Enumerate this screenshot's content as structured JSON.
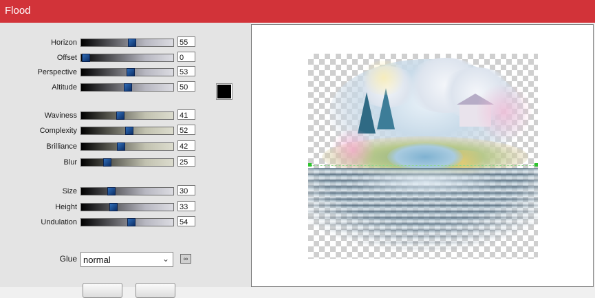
{
  "window": {
    "title": "Flood"
  },
  "sliders": [
    {
      "id": "horizon",
      "label": "Horizon",
      "value": "55",
      "fraction": 0.55,
      "style": "gray"
    },
    {
      "id": "offset",
      "label": "Offset",
      "value": "0",
      "fraction": 0.0,
      "style": "gray"
    },
    {
      "id": "perspective",
      "label": "Perspective",
      "value": "53",
      "fraction": 0.53,
      "style": "gray"
    },
    {
      "id": "altitude",
      "label": "Altitude",
      "value": "50",
      "fraction": 0.5,
      "style": "gray"
    },
    {
      "id": "waviness",
      "label": "Waviness",
      "value": "41",
      "fraction": 0.41,
      "style": "tan"
    },
    {
      "id": "complexity",
      "label": "Complexity",
      "value": "52",
      "fraction": 0.52,
      "style": "tan"
    },
    {
      "id": "brilliance",
      "label": "Brilliance",
      "value": "42",
      "fraction": 0.42,
      "style": "tan"
    },
    {
      "id": "blur",
      "label": "Blur",
      "value": "25",
      "fraction": 0.25,
      "style": "tan"
    },
    {
      "id": "size",
      "label": "Size",
      "value": "30",
      "fraction": 0.3,
      "style": "gray"
    },
    {
      "id": "height",
      "label": "Height",
      "value": "33",
      "fraction": 0.33,
      "style": "gray"
    },
    {
      "id": "undulation",
      "label": "Undulation",
      "value": "54",
      "fraction": 0.54,
      "style": "gray"
    }
  ],
  "color_swatch": {
    "color": "#000000"
  },
  "glue": {
    "label": "Glue",
    "value": "normal"
  },
  "colors": {
    "titlebar": "#d23339",
    "slider_thumb": "#2f6db8",
    "horizon_marker": "#2ec42e"
  },
  "preview": {
    "content": "flood-preview-image"
  }
}
